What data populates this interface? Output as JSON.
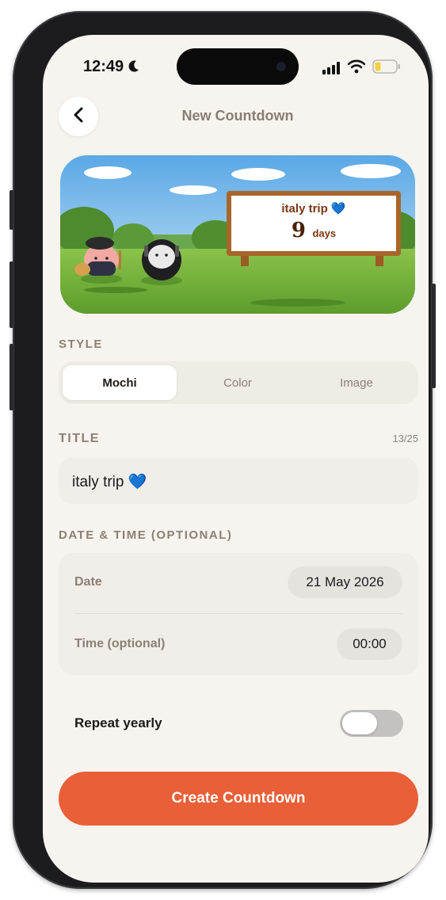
{
  "status_bar": {
    "time": "12:49"
  },
  "header": {
    "title": "New Countdown"
  },
  "preview": {
    "title": "italy trip",
    "heart": "💙",
    "count": "9",
    "unit": "days"
  },
  "style_section": {
    "label": "STYLE",
    "options": [
      "Mochi",
      "Color",
      "Image"
    ],
    "selected": "Mochi"
  },
  "title_section": {
    "label": "TITLE",
    "counter": "13/25",
    "value": "italy trip 💙"
  },
  "datetime_section": {
    "label": "DATE & TIME (OPTIONAL)",
    "date_label": "Date",
    "date_value": "21 May 2026",
    "time_label": "Time (optional)",
    "time_value": "00:00"
  },
  "repeat": {
    "label": "Repeat yearly",
    "enabled": false
  },
  "cta": {
    "label": "Create Countdown"
  },
  "colors": {
    "accent": "#e85f38",
    "background": "#f7f4ef",
    "muted_label": "#8c7f74"
  }
}
